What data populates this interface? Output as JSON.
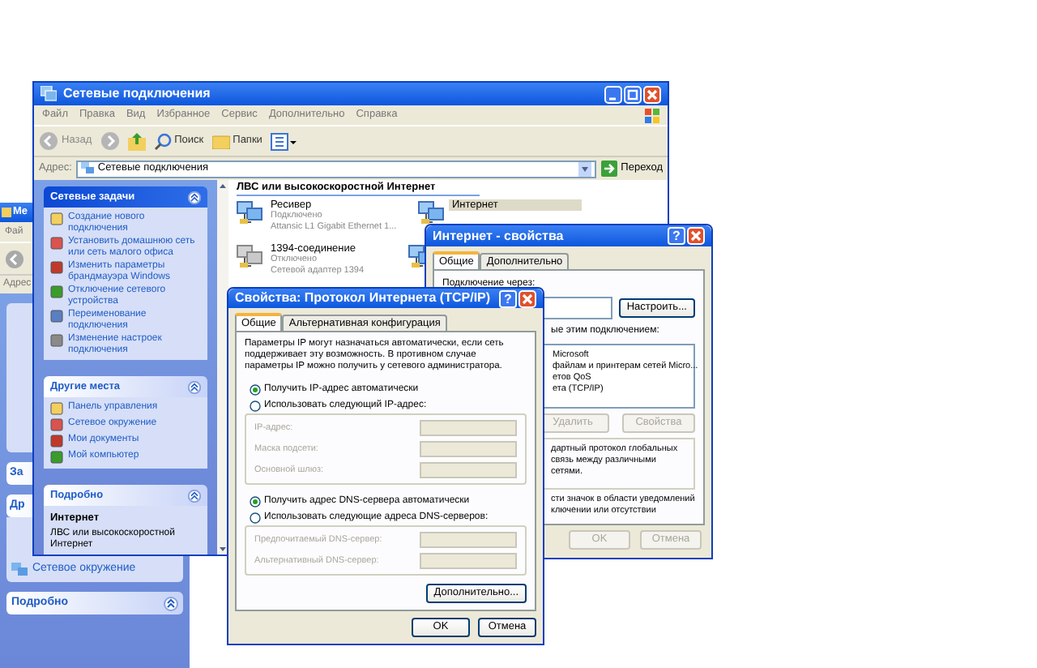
{
  "background_window": {
    "title": "Ме",
    "menu": "Фай",
    "address_label": "Адрес",
    "sections": [
      {
        "title": "За"
      },
      {
        "title": "Др"
      }
    ],
    "link": "Сетевое окружение",
    "details_title": "Подробно"
  },
  "explorer": {
    "title": "Сетевые подключения",
    "menu": [
      "Файл",
      "Правка",
      "Вид",
      "Избранное",
      "Сервис",
      "Дополнительно",
      "Справка"
    ],
    "toolbar": {
      "back": "Назад",
      "search": "Поиск",
      "folders": "Папки"
    },
    "address": {
      "label": "Адрес:",
      "value": "Сетевые подключения",
      "go": "Переход"
    },
    "task_panes": [
      {
        "title": "Сетевые задачи",
        "items": [
          "Создание нового подключения",
          "Установить домашнюю сеть или сеть малого офиса",
          "Изменить параметры брандмауэра Windows",
          "Отключение сетевого устройства",
          "Переименование подключения",
          "Изменение настроек подключения"
        ]
      },
      {
        "title": "Другие места",
        "items": [
          "Панель управления",
          "Сетевое окружение",
          "Мои документы",
          "Мой компьютер"
        ]
      }
    ],
    "details": {
      "title": "Подробно",
      "name": "Интернет",
      "type": "ЛВС или высокоскоростной Интернет"
    },
    "group_heading": "ЛВС или высокоскоростной Интернет",
    "connections": [
      {
        "name": "Ресивер",
        "status": "Подключено",
        "device": "Attansic L1 Gigabit Ethernet 1...",
        "selected": false
      },
      {
        "name": "Интернет",
        "selected": true
      },
      {
        "name": "1394-соединение",
        "status": "Отключено",
        "device": "Сетевой адаптер 1394",
        "selected": false
      }
    ]
  },
  "internet_properties": {
    "title": "Интернет - свойства",
    "help_button": "?",
    "tabs": [
      {
        "label": "Общие",
        "selected": true
      },
      {
        "label": "Дополнительно",
        "selected": false
      }
    ],
    "connect_via_label": "Подключение через:",
    "configure_button": "Настроить...",
    "components_label": "ые этим подключением:",
    "components": [
      "Microsoft",
      "файлам и принтерам сетей Micro...",
      "етов QoS",
      "ета (TCP/IP)"
    ],
    "buttons": [
      {
        "label": "Удалить",
        "disabled": true
      },
      {
        "label": "Свойства",
        "disabled": true
      }
    ],
    "description": [
      "дартный протокол глобальных",
      "связь между различными",
      "сетями."
    ],
    "notify": [
      "сти значок в области уведомлений",
      "ключении или отсутствии"
    ],
    "footer": [
      {
        "label": "OK",
        "disabled": true
      },
      {
        "label": "Отмена",
        "disabled": true
      }
    ]
  },
  "tcpip_dialog": {
    "title": "Свойства: Протокол Интернета (TCP/IP)",
    "help_button": "?",
    "tabs": [
      {
        "label": "Общие",
        "selected": true
      },
      {
        "label": "Альтернативная конфигурация",
        "selected": false
      }
    ],
    "intro": "Параметры IP могут назначаться автоматически, если сеть поддерживает эту возможность. В противном случае параметры IP можно получить у сетевого администратора.",
    "ip_options": [
      {
        "label": "Получить IP-адрес автоматически",
        "selected": true
      },
      {
        "label": "Использовать следующий IP-адрес:",
        "selected": false
      }
    ],
    "ip_fields": [
      {
        "label": "IP-адрес:",
        "disabled": true
      },
      {
        "label": "Маска подсети:",
        "disabled": true
      },
      {
        "label": "Основной шлюз:",
        "disabled": true
      }
    ],
    "dns_options": [
      {
        "label": "Получить адрес DNS-сервера автоматически",
        "selected": true
      },
      {
        "label": "Использовать следующие адреса DNS-серверов:",
        "selected": false
      }
    ],
    "dns_fields": [
      {
        "label": "Предпочитаемый DNS-сервер:",
        "disabled": true
      },
      {
        "label": "Альтернативный DNS-сервер:",
        "disabled": true
      }
    ],
    "advanced_button": "Дополнительно...",
    "ok_button": "OK",
    "cancel_button": "Отмена"
  }
}
